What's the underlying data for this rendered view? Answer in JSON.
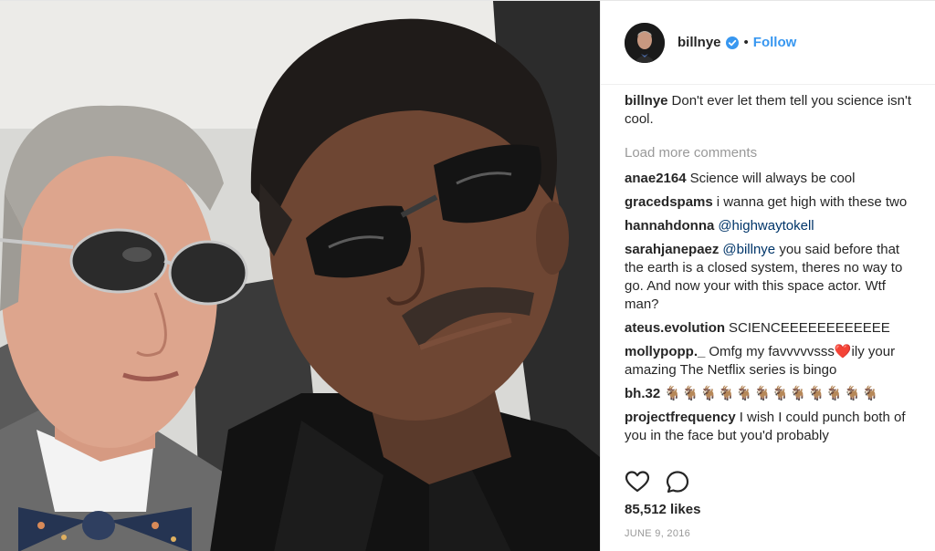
{
  "header": {
    "username": "billnye",
    "separator": "•",
    "follow_label": "Follow"
  },
  "icons": {
    "verified": "verified-badge-icon",
    "like": "heart-outline-icon",
    "comment": "comment-bubble-icon"
  },
  "colors": {
    "follow_blue": "#3897f0",
    "mention_blue": "#003569",
    "muted_gray": "#999999",
    "text": "#262626"
  },
  "caption": {
    "author": "billnye",
    "text": "Don't ever let them tell you science isn't cool."
  },
  "load_more_label": "Load more comments",
  "comments": [
    {
      "author": "anae2164",
      "text": "Science will always be cool"
    },
    {
      "author": "gracedspams",
      "text": "i wanna get high with these two"
    },
    {
      "author": "hannahdonna",
      "mention": "@highwaytokell",
      "text": ""
    },
    {
      "author": "sarahjanepaez",
      "mention": "@billnye",
      "text": "you said before that the earth is a closed system, theres no way to go. And now your with this space actor. Wtf man?"
    },
    {
      "author": "ateus.evolution",
      "text": "SCIENCEEEEEEEEEEEE"
    },
    {
      "author": "mollypopp._",
      "text_before": "Omfg my favvvvvsss",
      "emoji": "❤️",
      "text_after": "ily your amazing The Netflix series is bingo"
    },
    {
      "author": "bh.32",
      "text": "🐐🐐🐐🐐🐐🐐🐐🐐🐐🐐🐐🐐"
    },
    {
      "author": "projectfrequency",
      "text": "I wish I could punch both of you in the face but you'd probably"
    }
  ],
  "likes_label": "85,512 likes",
  "date_label": "JUNE 9, 2016"
}
